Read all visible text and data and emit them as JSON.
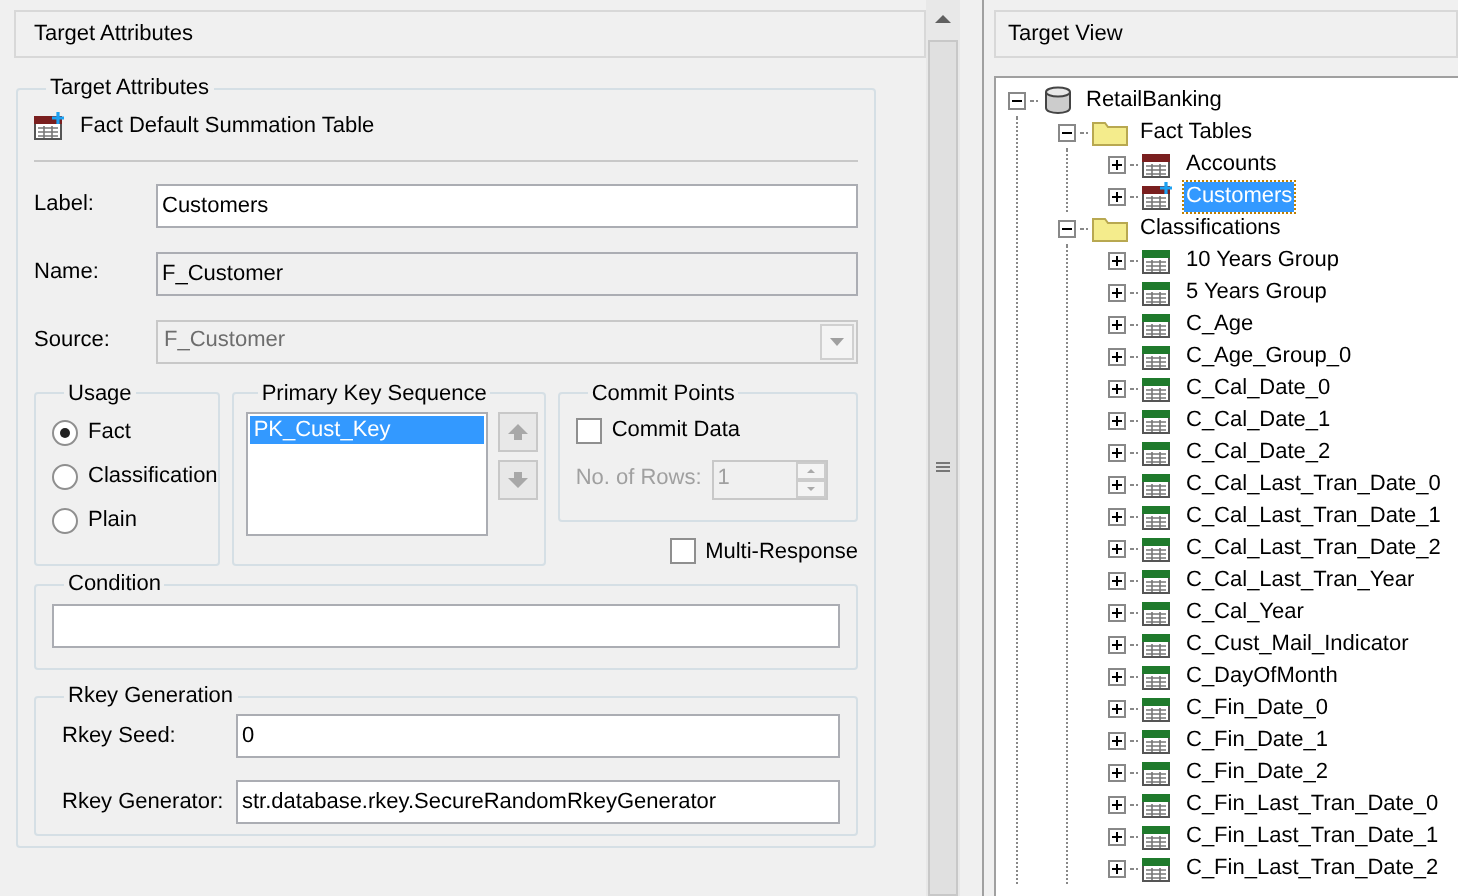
{
  "left_panel": {
    "header": "Target Attributes",
    "group_title": "Target Attributes",
    "table_type": "Fact Default Summation Table",
    "fields": [
      {
        "label": "Label:",
        "value": "Customers",
        "kind": "editable"
      },
      {
        "label": "Name:",
        "value": "F_Customer",
        "kind": "readonly"
      },
      {
        "label": "Source:",
        "value": "F_Customer",
        "kind": "dropdown"
      }
    ],
    "usage": {
      "title": "Usage",
      "options": [
        {
          "label": "Fact",
          "selected": true
        },
        {
          "label": "Classification",
          "selected": false
        },
        {
          "label": "Plain",
          "selected": false
        }
      ]
    },
    "primary_key_sequence": {
      "title": "Primary Key Sequence",
      "items": [
        {
          "label": "PK_Cust_Key",
          "selected": true
        }
      ]
    },
    "commit_points": {
      "title": "Commit Points",
      "commit_data": {
        "label": "Commit Data",
        "checked": false
      },
      "rows_label": "No. of Rows:",
      "rows_value": "1",
      "disabled": true
    },
    "multi_response": {
      "label": "Multi-Response",
      "checked": false
    },
    "condition": {
      "title": "Condition"
    },
    "rkey_generation": {
      "title": "Rkey Generation",
      "fields": [
        {
          "label": "Rkey Seed:",
          "value": "0"
        },
        {
          "label": "Rkey Generator:",
          "value": "str.database.rkey.SecureRandomRkeyGenerator"
        }
      ]
    }
  },
  "right_panel": {
    "header": "Target View",
    "tree": [
      {
        "label": "RetailBanking",
        "kind": "database",
        "expanded": true,
        "selected": false,
        "children": [
          {
            "label": "Fact Tables",
            "kind": "folder",
            "expanded": true,
            "selected": false,
            "children": [
              {
                "label": "Accounts",
                "kind": "fact",
                "expanded": false,
                "selected": false
              },
              {
                "label": "Customers",
                "kind": "fact_default",
                "expanded": false,
                "selected": true
              }
            ]
          },
          {
            "label": "Classifications",
            "kind": "folder",
            "expanded": true,
            "selected": false,
            "children": [
              {
                "label": "10 Years Group",
                "kind": "classification",
                "expanded": false,
                "selected": false
              },
              {
                "label": "5 Years Group",
                "kind": "classification",
                "expanded": false,
                "selected": false
              },
              {
                "label": "C_Age",
                "kind": "classification",
                "expanded": false,
                "selected": false
              },
              {
                "label": "C_Age_Group_0",
                "kind": "classification",
                "expanded": false,
                "selected": false
              },
              {
                "label": "C_Cal_Date_0",
                "kind": "classification",
                "expanded": false,
                "selected": false
              },
              {
                "label": "C_Cal_Date_1",
                "kind": "classification",
                "expanded": false,
                "selected": false
              },
              {
                "label": "C_Cal_Date_2",
                "kind": "classification",
                "expanded": false,
                "selected": false
              },
              {
                "label": "C_Cal_Last_Tran_Date_0",
                "kind": "classification",
                "expanded": false,
                "selected": false
              },
              {
                "label": "C_Cal_Last_Tran_Date_1",
                "kind": "classification",
                "expanded": false,
                "selected": false
              },
              {
                "label": "C_Cal_Last_Tran_Date_2",
                "kind": "classification",
                "expanded": false,
                "selected": false
              },
              {
                "label": "C_Cal_Last_Tran_Year",
                "kind": "classification",
                "expanded": false,
                "selected": false
              },
              {
                "label": "C_Cal_Year",
                "kind": "classification",
                "expanded": false,
                "selected": false
              },
              {
                "label": "C_Cust_Mail_Indicator",
                "kind": "classification",
                "expanded": false,
                "selected": false
              },
              {
                "label": "C_DayOfMonth",
                "kind": "classification",
                "expanded": false,
                "selected": false
              },
              {
                "label": "C_Fin_Date_0",
                "kind": "classification",
                "expanded": false,
                "selected": false
              },
              {
                "label": "C_Fin_Date_1",
                "kind": "classification",
                "expanded": false,
                "selected": false
              },
              {
                "label": "C_Fin_Date_2",
                "kind": "classification",
                "expanded": false,
                "selected": false
              },
              {
                "label": "C_Fin_Last_Tran_Date_0",
                "kind": "classification",
                "expanded": false,
                "selected": false
              },
              {
                "label": "C_Fin_Last_Tran_Date_1",
                "kind": "classification",
                "expanded": false,
                "selected": false
              },
              {
                "label": "C_Fin_Last_Tran_Date_2",
                "kind": "classification",
                "expanded": false,
                "selected": false
              }
            ]
          }
        ]
      }
    ]
  }
}
